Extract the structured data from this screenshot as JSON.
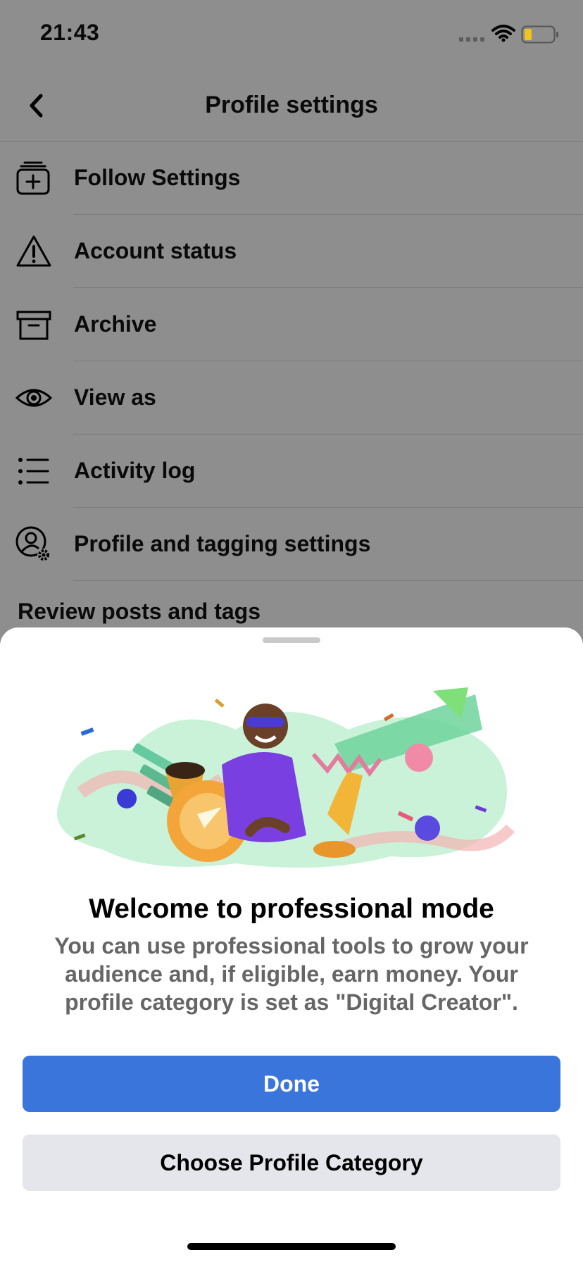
{
  "status_bar": {
    "time": "21:43"
  },
  "header": {
    "title": "Profile settings"
  },
  "menu": [
    {
      "label": "Follow Settings",
      "icon": "follow-settings-icon"
    },
    {
      "label": "Account status",
      "icon": "warning-icon"
    },
    {
      "label": "Archive",
      "icon": "archive-icon"
    },
    {
      "label": "View as",
      "icon": "eye-icon"
    },
    {
      "label": "Activity log",
      "icon": "list-icon"
    },
    {
      "label": "Profile and tagging settings",
      "icon": "profile-gear-icon"
    }
  ],
  "section": {
    "title": "Review posts and tags"
  },
  "sheet": {
    "title": "Welcome to professional mode",
    "description": "You can use professional tools to grow your audience and, if eligible, earn money. Your profile category is set as \"Digital Creator\".",
    "done_label": "Done",
    "category_label": "Choose Profile Category"
  },
  "colors": {
    "overlay": "#8e8e8e",
    "primary": "#3a75db",
    "secondary": "#e5e6eb",
    "description": "#666666"
  }
}
